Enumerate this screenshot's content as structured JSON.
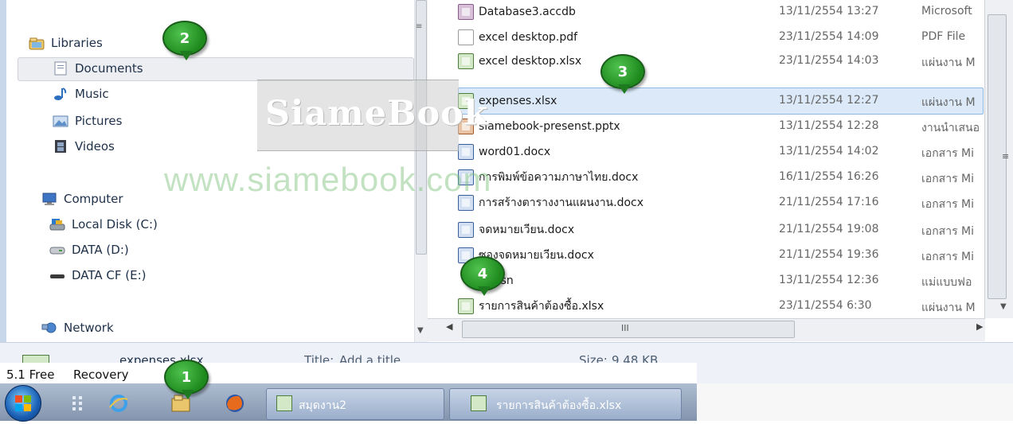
{
  "nav": {
    "libraries": "Libraries",
    "documents": "Documents",
    "music": "Music",
    "pictures": "Pictures",
    "videos": "Videos",
    "computer": "Computer",
    "local_disk": "Local Disk (C:)",
    "data_d": "DATA (D:)",
    "data_e": "DATA CF (E:)",
    "network": "Network"
  },
  "files": [
    {
      "name": "Database3.accdb",
      "date": "13/11/2554 13:27",
      "type": "Microsoft",
      "icon": "access-file-icon"
    },
    {
      "name": "excel desktop.pdf",
      "date": "23/11/2554 14:09",
      "type": "PDF File",
      "icon": "pdf-file-icon"
    },
    {
      "name": "excel desktop.xlsx",
      "date": "23/11/2554 14:03",
      "type": "แผ่นงาน M",
      "icon": "excel-file-icon"
    },
    {
      "name": "expenses.xlsx",
      "date": "13/11/2554 12:27",
      "type": "แผ่นงาน M",
      "icon": "excel-file-icon"
    },
    {
      "name": "siamebook-presenst.pptx",
      "date": "13/11/2554 12:28",
      "type": "งานนำเสนอ",
      "icon": "powerpoint-file-icon"
    },
    {
      "name": "word01.docx",
      "date": "13/11/2554 14:02",
      "type": "เอกสาร Mi",
      "icon": "word-file-icon"
    },
    {
      "name": "การพิมพ์ข้อความภาษาไทย.docx",
      "date": "16/11/2554 16:26",
      "type": "เอกสาร Mi",
      "icon": "word-file-icon"
    },
    {
      "name": "การสร้างตารางงานแผนงาน.docx",
      "date": "21/11/2554 17:16",
      "type": "เอกสาร Mi",
      "icon": "word-file-icon"
    },
    {
      "name": "จดหมายเวียน.docx",
      "date": "21/11/2554 19:08",
      "type": "เอกสาร Mi",
      "icon": "word-file-icon"
    },
    {
      "name": "ซองจดหมายเวียน.docx",
      "date": "21/11/2554 19:36",
      "type": "เอกสาร Mi",
      "icon": "word-file-icon"
    },
    {
      "name": "1.xsn",
      "date": "13/11/2554 12:36",
      "type": "แม่แบบฟอ",
      "icon": "infopath-file-icon"
    },
    {
      "name": "รายการสินค้าต้องซื้อ.xlsx",
      "date": "23/11/2554 6:30",
      "type": "แผ่นงาน M",
      "icon": "excel-file-icon"
    }
  ],
  "details": {
    "filename": "expenses.xlsx",
    "title_label": "Title:",
    "title_value": "Add a title",
    "size_label": "Size:",
    "size_value": "9.48 KB"
  },
  "tray": {
    "item1": "5.1 Free",
    "item2": "Recovery"
  },
  "taskbar": {
    "window1": "สมุดงาน2",
    "window2": "รายการสินค้าต้องซื้อ.xlsx"
  },
  "watermark": {
    "logo": "SiameBook",
    "url": "www.siamebook.com"
  },
  "badges": [
    "1",
    "2",
    "3",
    "4"
  ],
  "scroll": {
    "hscroll_glyph": "III",
    "vscroll_glyph": "≡"
  },
  "colors": {
    "selection": "#dbe9f8",
    "badge": "#2a9a2a",
    "taskbar": "#8ea0b8"
  }
}
